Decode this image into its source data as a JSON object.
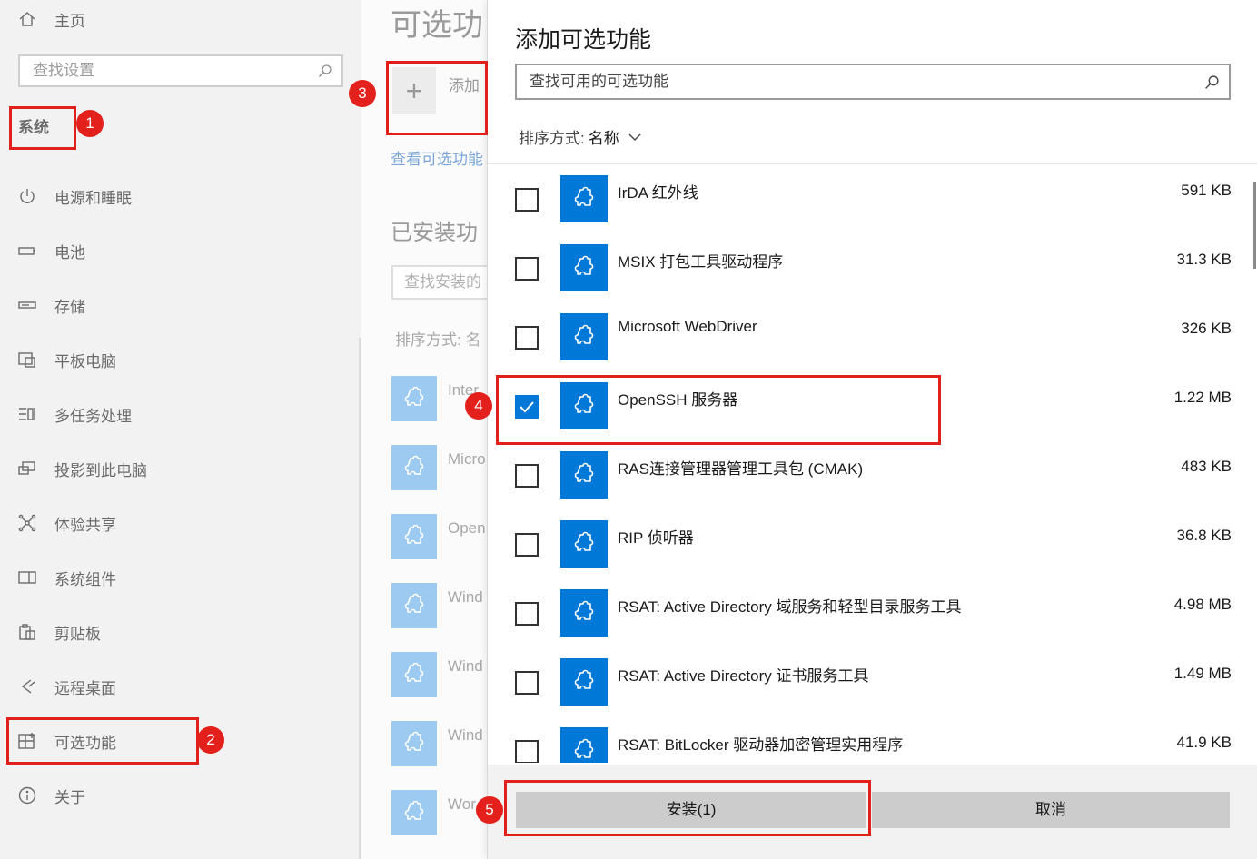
{
  "sidebar": {
    "home_label": "主页",
    "search_placeholder": "查找设置",
    "section_title": "系统",
    "items": [
      {
        "label": "电源和睡眠",
        "icon": "power-icon"
      },
      {
        "label": "电池",
        "icon": "battery-icon"
      },
      {
        "label": "存储",
        "icon": "storage-icon"
      },
      {
        "label": "平板电脑",
        "icon": "tablet-icon"
      },
      {
        "label": "多任务处理",
        "icon": "multitasking-icon"
      },
      {
        "label": "投影到此电脑",
        "icon": "project-icon"
      },
      {
        "label": "体验共享",
        "icon": "shared-experiences-icon"
      },
      {
        "label": "系统组件",
        "icon": "system-components-icon"
      },
      {
        "label": "剪贴板",
        "icon": "clipboard-icon"
      },
      {
        "label": "远程桌面",
        "icon": "remote-desktop-icon"
      },
      {
        "label": "可选功能",
        "icon": "optional-features-icon"
      },
      {
        "label": "关于",
        "icon": "info-icon"
      }
    ]
  },
  "page": {
    "title": "可选功",
    "add_label": "添加",
    "view_link": "查看可选功能",
    "installed_heading": "已安装功",
    "installed_search_placeholder": "查找安装的",
    "sort_label": "排序方式: 名",
    "installed_items": [
      "Inter",
      "Micro",
      "Open",
      "Wind",
      "Wind",
      "Wind",
      "Wor"
    ]
  },
  "dialog": {
    "title": "添加可选功能",
    "search_placeholder": "查找可用的可选功能",
    "sort_label": "排序方式:",
    "sort_value": "名称",
    "features": [
      {
        "name": "IrDA 红外线",
        "size": "591 KB",
        "checked": false
      },
      {
        "name": "MSIX 打包工具驱动程序",
        "size": "31.3 KB",
        "checked": false
      },
      {
        "name": "Microsoft WebDriver",
        "size": "326 KB",
        "checked": false
      },
      {
        "name": "OpenSSH 服务器",
        "size": "1.22 MB",
        "checked": true
      },
      {
        "name": "RAS连接管理器管理工具包 (CMAK)",
        "size": "483 KB",
        "checked": false
      },
      {
        "name": "RIP 侦听器",
        "size": "36.8 KB",
        "checked": false
      },
      {
        "name": "RSAT: Active Directory 域服务和轻型目录服务工具",
        "size": "4.98 MB",
        "checked": false
      },
      {
        "name": "RSAT: Active Directory 证书服务工具",
        "size": "1.49 MB",
        "checked": false
      },
      {
        "name": "RSAT: BitLocker 驱动器加密管理实用程序",
        "size": "41.9 KB",
        "checked": false
      }
    ],
    "install_label": "安装(1)",
    "cancel_label": "取消"
  },
  "annotations": {
    "steps": [
      "1",
      "2",
      "3",
      "4",
      "5"
    ],
    "color": "#e0201b"
  },
  "colors": {
    "accent": "#0078d7",
    "accent_light": "#9dcaf0"
  }
}
